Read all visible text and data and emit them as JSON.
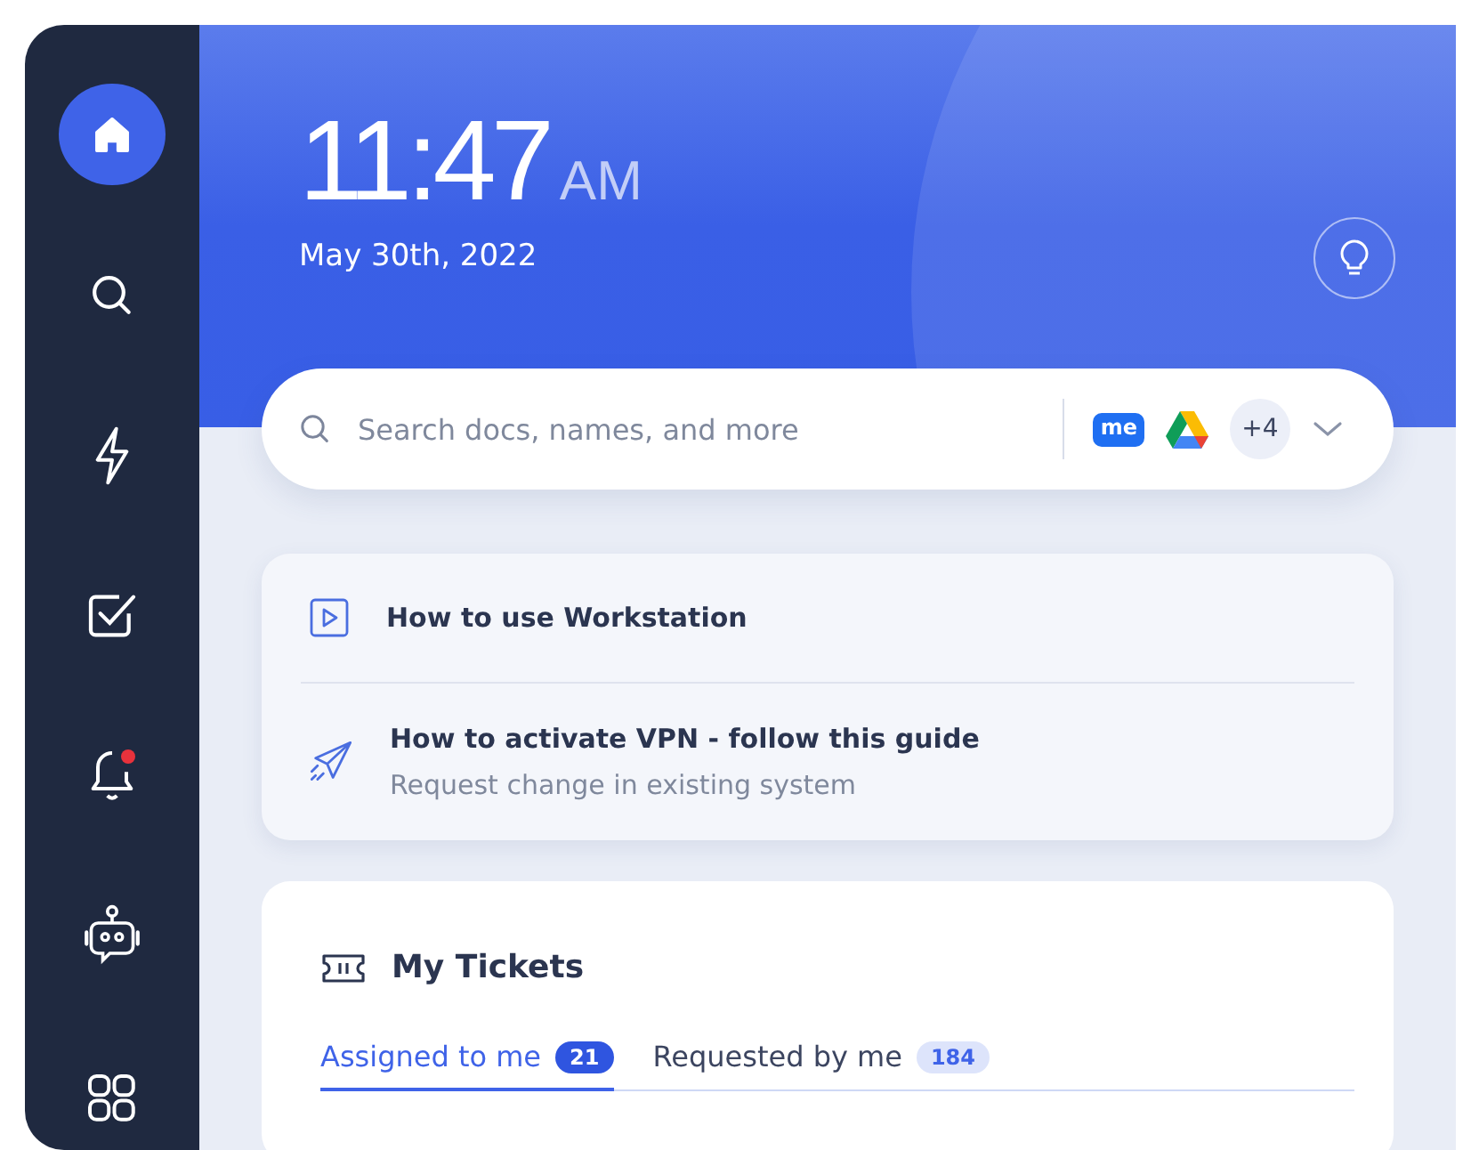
{
  "sidebar": {
    "items": [
      {
        "kind": "home",
        "selected": true,
        "notification": false
      },
      {
        "kind": "search",
        "selected": false,
        "notification": false
      },
      {
        "kind": "bolt",
        "selected": false,
        "notification": false
      },
      {
        "kind": "tasks",
        "selected": false,
        "notification": false
      },
      {
        "kind": "bell",
        "selected": false,
        "notification": true
      },
      {
        "kind": "bot",
        "selected": false,
        "notification": false
      },
      {
        "kind": "apps",
        "selected": false,
        "notification": false
      }
    ]
  },
  "clock": {
    "time": "11:47",
    "period": "AM",
    "date": "May 30th, 2022"
  },
  "search": {
    "placeholder": "Search docs, names, and more",
    "sources": [
      {
        "kind": "chat",
        "label": "me"
      },
      {
        "kind": "drive"
      }
    ],
    "more_count": "+4"
  },
  "guides": [
    {
      "kind": "video",
      "title": "How to use Workstation"
    },
    {
      "kind": "send",
      "title": "How to activate VPN - follow this guide",
      "subtitle": "Request change in existing system"
    }
  ],
  "tickets": {
    "title": "My Tickets",
    "tabs": [
      {
        "label": "Assigned to me",
        "count": "21",
        "selected": true
      },
      {
        "label": "Requested by me",
        "count": "184",
        "selected": false
      }
    ]
  }
}
